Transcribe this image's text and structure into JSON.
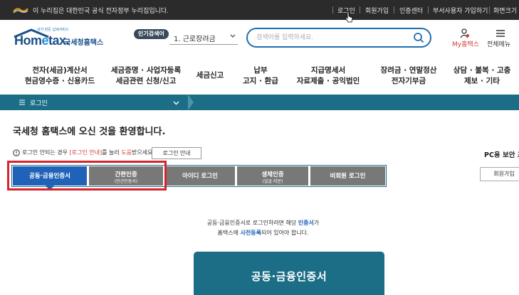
{
  "topbar": {
    "gov_notice": "이 누리집은 대한민국 공식 전자정부 누리집입니다.",
    "links": [
      "로그인",
      "회원가입",
      "인증센터",
      "부서사용자 가입하기",
      "화면크기"
    ]
  },
  "header": {
    "logo_text_prefix": "Hom",
    "logo_text_mid": "e",
    "logo_text_suffix": "tax.",
    "logo_slogan": "내가 만든 납세서비스",
    "logo_korean": "국세청홈택스",
    "popular_badge": "인기검색어",
    "popular_item": "1.  근로장려금",
    "search_placeholder": "검색어를 입력하세요.",
    "my_label": "My홈택스",
    "menu_label": "전체메뉴"
  },
  "nav": {
    "items": [
      {
        "line1": "전자(세금)계산서",
        "line2": "현금영수증 · 신용카드"
      },
      {
        "line1": "세금증명 · 사업자등록",
        "line2": "세금관련 신청/신고"
      },
      {
        "line1": "세금신고",
        "line2": ""
      },
      {
        "line1": "납부",
        "line2": "고지 · 환급"
      },
      {
        "line1": "지급명세서",
        "line2": "자료제출 · 공익법인"
      },
      {
        "line1": "장려금 · 연말정산",
        "line2": "전자기부금"
      },
      {
        "line1": "상담 · 불복 · 고충",
        "line2": "제보 · 기타"
      }
    ]
  },
  "breadcrumb": {
    "label": "로그인"
  },
  "content": {
    "welcome": "국세청 홈택스에 오신 것을 환영합니다.",
    "notice_prefix": "로그인 안되는 경우 ",
    "notice_link1": "[로그인 안내]",
    "notice_mid": "를 눌러 ",
    "notice_link2": "도움",
    "notice_suffix": "받으세요.",
    "guide_button": "로그인 안내",
    "pc_notice": "PC용 보안 프",
    "join_button": "회원가입",
    "tabs": [
      {
        "label": "공동·금융인증서",
        "sub": "",
        "active": true
      },
      {
        "label": "간편인증",
        "sub": "(민간인증서)",
        "active": false
      },
      {
        "label": "아이디 로그인",
        "sub": "",
        "active": false
      },
      {
        "label": "생체인증",
        "sub": "(얼굴·지문)",
        "active": false
      },
      {
        "label": "비회원 로그인",
        "sub": "",
        "active": false
      }
    ],
    "desc1_prefix": "공동·금융인증서로 로그인하려면 해당 ",
    "desc1_blue": "인증서",
    "desc1_suffix": "가",
    "desc2_prefix": "홈택스에 ",
    "desc2_blue": "사전등록",
    "desc2_suffix": "되어 있어야 합니다.",
    "card_label": "공동·금융인증서"
  },
  "colors": {
    "topbar": "#2b2b2b",
    "teal": "#1c6e86",
    "active_tab": "#1f62b8",
    "inactive_tab": "#787878",
    "highlight": "#d6232d"
  }
}
